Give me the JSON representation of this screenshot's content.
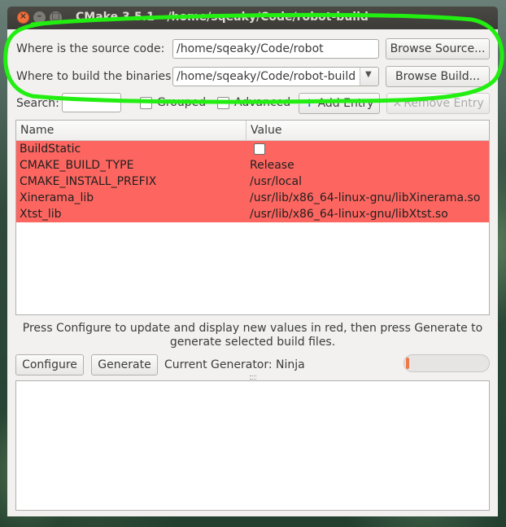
{
  "window": {
    "title": "CMake 3.5.1 - /home/sqeaky/Code/robot-build",
    "close_glyph": "×",
    "minimize_glyph": "–",
    "maximize_glyph": "□"
  },
  "source": {
    "label": "Where is the source code:",
    "value": "/home/sqeaky/Code/robot",
    "browse_label": "Browse Source..."
  },
  "build": {
    "label": "Where to build the binaries:",
    "value": "/home/sqeaky/Code/robot-build",
    "browse_label": "Browse Build..."
  },
  "search": {
    "label": "Search:",
    "value": ""
  },
  "options": {
    "grouped_label": "Grouped",
    "grouped_checked": false,
    "advanced_label": "Advanced",
    "advanced_checked": false
  },
  "toolbar": {
    "add_entry_label": "Add Entry",
    "remove_entry_label": "Remove Entry"
  },
  "table": {
    "columns": [
      "Name",
      "Value"
    ],
    "rows": [
      {
        "name": "BuildStatic",
        "value": "",
        "checkbox": true,
        "checked": false
      },
      {
        "name": "CMAKE_BUILD_TYPE",
        "value": "Release"
      },
      {
        "name": "CMAKE_INSTALL_PREFIX",
        "value": "/usr/local"
      },
      {
        "name": "Xinerama_lib",
        "value": "/usr/lib/x86_64-linux-gnu/libXinerama.so"
      },
      {
        "name": "Xtst_lib",
        "value": "/usr/lib/x86_64-linux-gnu/libXtst.so"
      }
    ],
    "highlight_color": "#fd6660"
  },
  "info": {
    "line1": "Press Configure to update and display new values in red, then press Generate to",
    "line2": "generate selected build files."
  },
  "actions": {
    "configure_label": "Configure",
    "generate_label": "Generate",
    "generator_text": "Current Generator: Ninja"
  },
  "progress": {
    "value_fraction": 0.03,
    "color": "#f07746"
  },
  "output": {
    "text": ""
  },
  "annotation": {
    "color": "#22ee11"
  }
}
